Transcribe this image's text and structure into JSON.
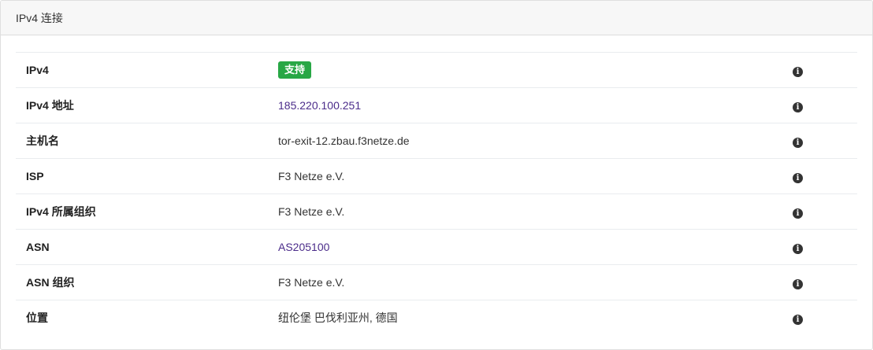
{
  "header": {
    "title": "IPv4 连接"
  },
  "rows": [
    {
      "label": "IPv4",
      "value": "支持",
      "type": "badge"
    },
    {
      "label": "IPv4 地址",
      "value": "185.220.100.251",
      "type": "link"
    },
    {
      "label": "主机名",
      "value": "tor-exit-12.zbau.f3netze.de",
      "type": "text"
    },
    {
      "label": "ISP",
      "value": "F3 Netze e.V.",
      "type": "text"
    },
    {
      "label": "IPv4 所属组织",
      "value": "F3 Netze e.V.",
      "type": "text"
    },
    {
      "label": "ASN",
      "value": "AS205100",
      "type": "link"
    },
    {
      "label": "ASN 组织",
      "value": "F3 Netze e.V.",
      "type": "text"
    },
    {
      "label": "位置",
      "value": "纽伦堡 巴伐利亚州, 德国",
      "type": "text"
    }
  ],
  "icons": {
    "info": "info-icon",
    "info_glyph": "i"
  },
  "colors": {
    "badge": "#28a745",
    "link": "#4b2c8a",
    "header_bg": "#f7f7f7"
  }
}
